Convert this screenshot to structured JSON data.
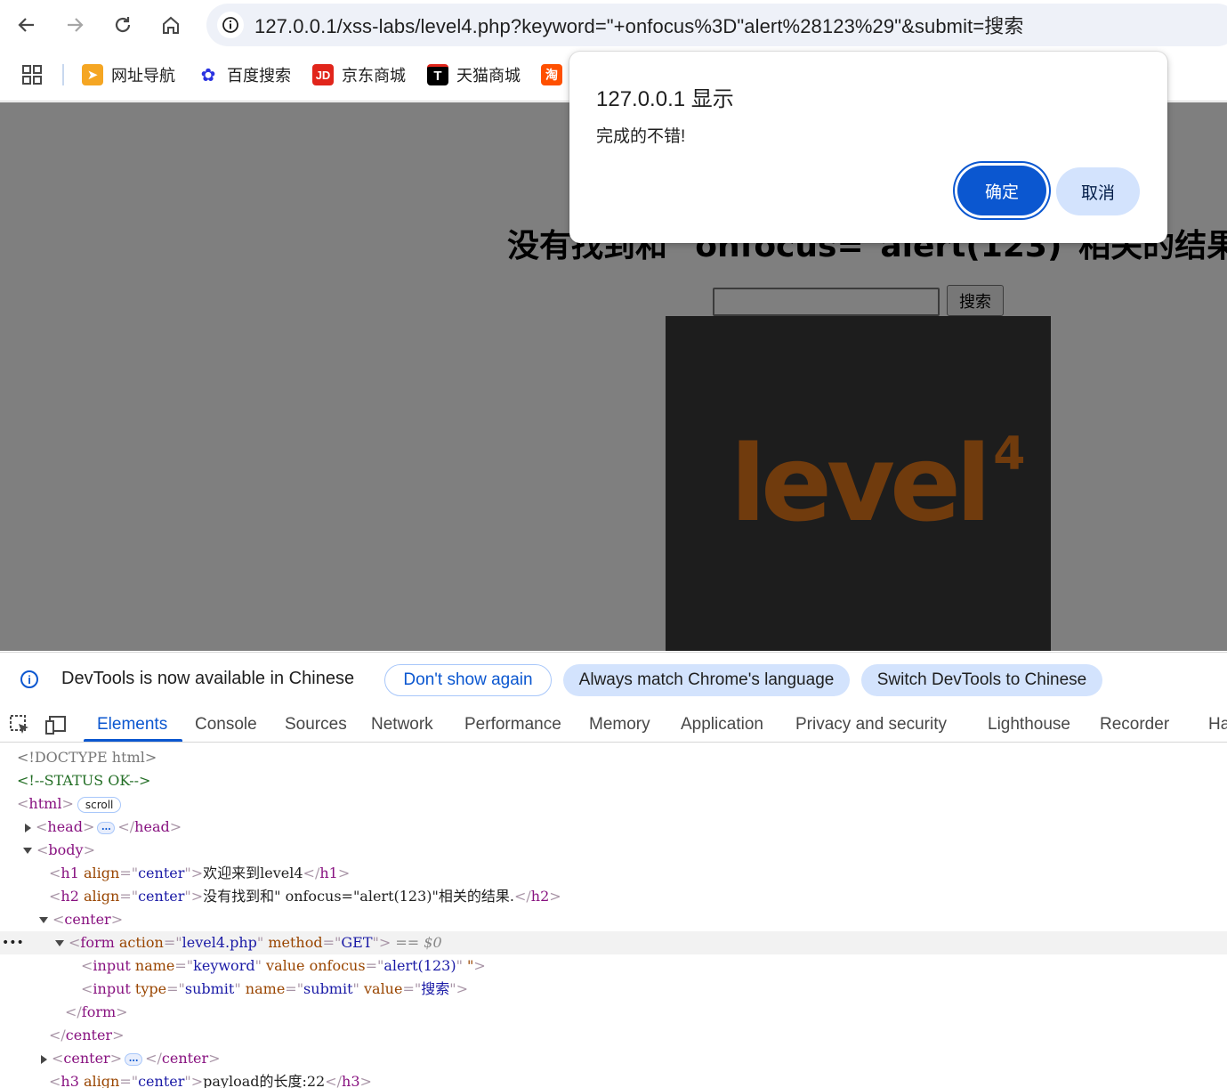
{
  "browser": {
    "url": "127.0.0.1/xss-labs/level4.php?keyword=\"+onfocus%3D\"alert%28123%29\"&submit=搜索",
    "bookmarks": [
      {
        "label": "网址导航",
        "icon": "arrow-icon",
        "color": "#f5a623"
      },
      {
        "label": "百度搜索",
        "icon": "baidu-paw-icon",
        "color": "#2932e1"
      },
      {
        "label": "京东商城",
        "icon": "jd-icon",
        "color": "#e1251b"
      },
      {
        "label": "天猫商城",
        "icon": "tmall-icon",
        "color": "#000000"
      },
      {
        "label": "",
        "icon": "taobao-icon",
        "color": "#ff5000"
      }
    ]
  },
  "page": {
    "heading": "没有找到和\" onfocus=\"alert(123)\"相关的结果.",
    "submit_label": "搜索",
    "logo_text": "level",
    "logo_sup": "4"
  },
  "dialog": {
    "title": "127.0.0.1 显示",
    "message": "完成的不错!",
    "ok_label": "确定",
    "cancel_label": "取消"
  },
  "devtools": {
    "infobar": {
      "text": "DevTools is now available in Chinese",
      "dont_show": "Don't show again",
      "always_match": "Always match Chrome's language",
      "switch": "Switch DevTools to Chinese"
    },
    "tabs": [
      "Elements",
      "Console",
      "Sources",
      "Network",
      "Performance",
      "Memory",
      "Application",
      "Privacy and security",
      "Lighthouse",
      "Recorder",
      "Ha"
    ],
    "active_tab": "Elements",
    "dom": {
      "doctype": "<!DOCTYPE html>",
      "comment": "<!--STATUS OK-->",
      "html_tag": "html",
      "scroll_badge": "scroll",
      "head_tag": "head",
      "body_tag": "body",
      "h1_text": "欢迎来到level4",
      "h2_text": "没有找到和\" onfocus=\"alert(123)\"相关的结果.",
      "form_action": "level4.php",
      "form_method": "GET",
      "eq_ref": "== $0",
      "input1_name": "keyword",
      "input1_onfocus": "alert(123)",
      "input2_type": "submit",
      "input2_name": "submit",
      "input2_value": "搜索",
      "h3_text": "payload的长度:22"
    }
  }
}
